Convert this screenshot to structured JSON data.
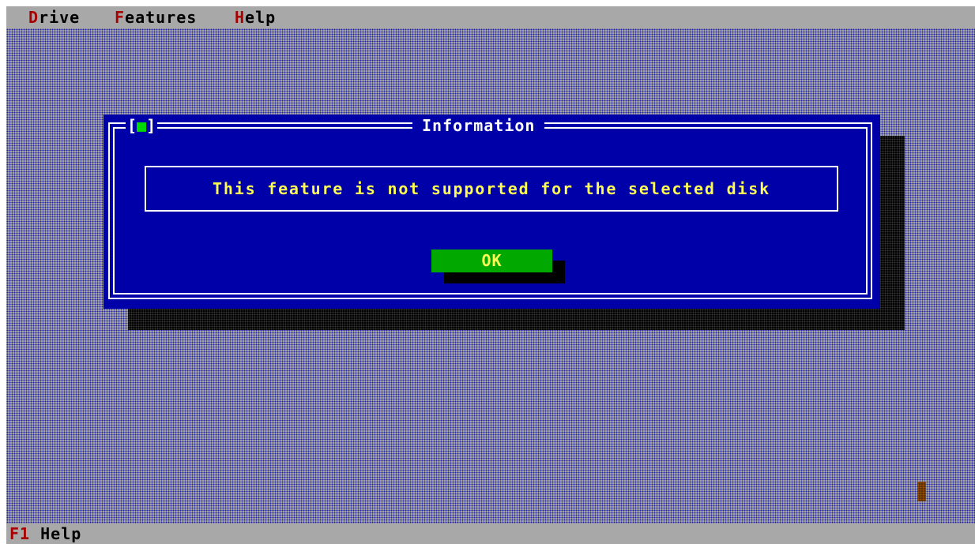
{
  "menubar": {
    "items": [
      {
        "hotkey": "D",
        "rest": "rive"
      },
      {
        "hotkey": "F",
        "rest": "eatures"
      },
      {
        "hotkey": "H",
        "rest": "elp"
      }
    ]
  },
  "dialog": {
    "close_box": {
      "left": "[",
      "glyph": "■",
      "right": "]"
    },
    "title": "Information",
    "message": "This feature is not supported for the selected disk",
    "ok_label": "OK"
  },
  "statusbar": {
    "key": "F1",
    "label": "Help"
  },
  "colors": {
    "desktop_gray": "#a8a8a8",
    "desktop_dither": "#2020a8",
    "dialog_blue": "#0000a8",
    "message_yellow": "#fcfc54",
    "button_green": "#00a800",
    "hotkey_red": "#a80000",
    "indicator_brown": "#5a3000"
  }
}
